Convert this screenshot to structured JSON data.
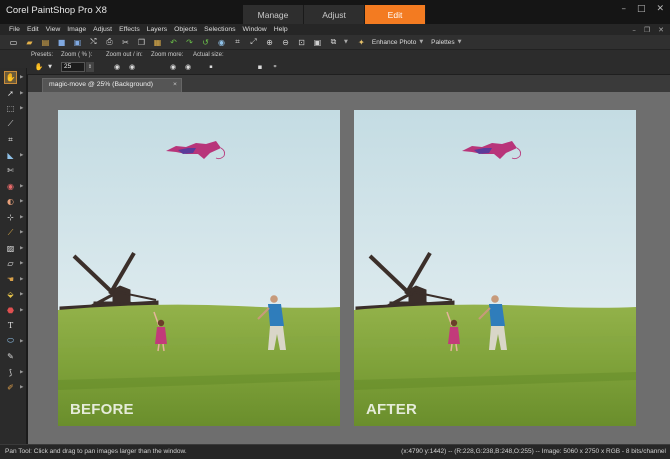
{
  "app": {
    "title": "Corel PaintShop Pro X8"
  },
  "workspace_tabs": [
    {
      "label": "Manage",
      "active": false
    },
    {
      "label": "Adjust",
      "active": false
    },
    {
      "label": "Edit",
      "active": true
    }
  ],
  "window_controls": {
    "minimize": "–",
    "maximize": "□",
    "close": "✕"
  },
  "menu": [
    "File",
    "Edit",
    "View",
    "Image",
    "Adjust",
    "Effects",
    "Layers",
    "Objects",
    "Selections",
    "Window",
    "Help"
  ],
  "mdi_controls": {
    "minimize": "–",
    "restore": "❐",
    "close": "✕"
  },
  "toolbar": {
    "enhance_photo_label": "Enhance Photo",
    "palettes_label": "Palettes"
  },
  "tool_options": {
    "presets_label": "Presets:",
    "zoom_label": "Zoom ( % ):",
    "zoom_value": "25",
    "zoom_out_in_label": "Zoom out / in:",
    "zoom_more_label": "Zoom more:",
    "actual_size_label": "Actual size:"
  },
  "document": {
    "tab_title": "magic-move @  25% (Background)",
    "close_glyph": "×",
    "before_label": "BEFORE",
    "after_label": "AFTER"
  },
  "status": {
    "hint": "Pan Tool: Click and drag to pan images larger than the window.",
    "info": "(x:4790 y:1442) -- (R:228,G:238,B:248,O:255) -- Image:  5060 x 2750 x RGB - 8 bits/channel"
  },
  "colors": {
    "accent": "#f37b21",
    "sky_top": "#c5dde4",
    "sky_bottom": "#e9f2f4",
    "grass": "#7da23a"
  }
}
